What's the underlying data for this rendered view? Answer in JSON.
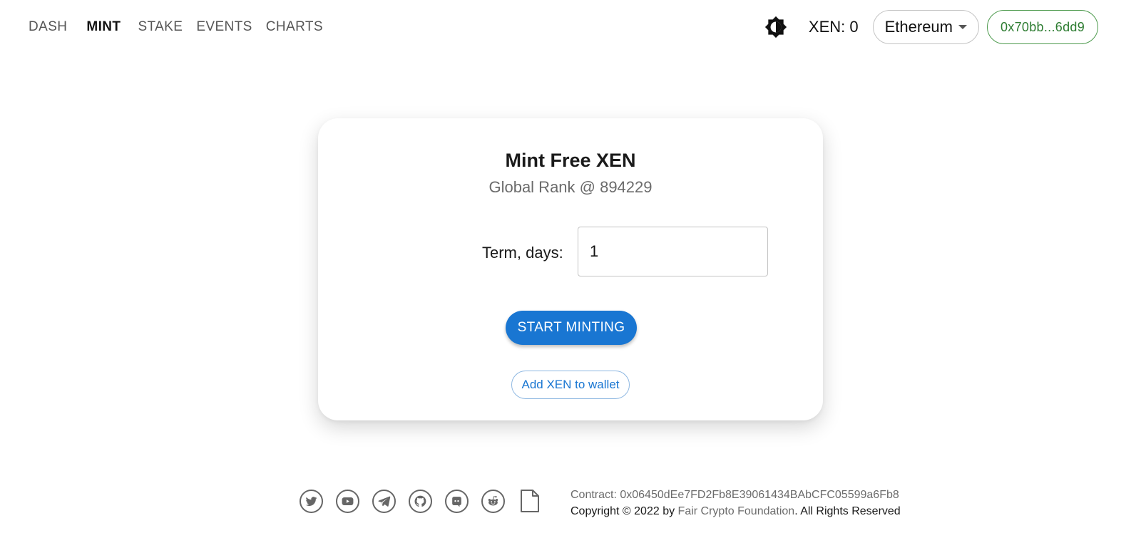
{
  "nav": {
    "items": [
      {
        "label": "DASH",
        "active": false
      },
      {
        "label": "MINT",
        "active": true
      },
      {
        "label": "STAKE",
        "active": false
      },
      {
        "label": "EVENTS",
        "active": false
      },
      {
        "label": "CHARTS",
        "active": false
      }
    ]
  },
  "header": {
    "theme_icon": "brightness-icon",
    "xen_balance": "XEN: 0",
    "network": "Ethereum",
    "wallet_address": "0x70bb...6dd9"
  },
  "mint_card": {
    "title": "Mint Free XEN",
    "subtitle": "Global Rank @ 894229",
    "term_label": "Term, days:",
    "term_value": "1",
    "start_button": "START MINTING",
    "add_wallet_button": "Add XEN to wallet"
  },
  "footer": {
    "social_icons": [
      "twitter-icon",
      "youtube-icon",
      "telegram-icon",
      "github-icon",
      "discord-icon",
      "reddit-icon",
      "document-icon"
    ],
    "contract_text": "Contract: 0x06450dEe7FD2Fb8E39061434BAbCFC05599a6Fb8",
    "copyright_prefix": "Copyright © 2022 by ",
    "copyright_link": "Fair Crypto Foundation",
    "copyright_suffix": ". All Rights Reserved"
  },
  "colors": {
    "primary": "#1976d2",
    "wallet_green": "#2e7d32",
    "text_muted": "#6b6b6b"
  }
}
